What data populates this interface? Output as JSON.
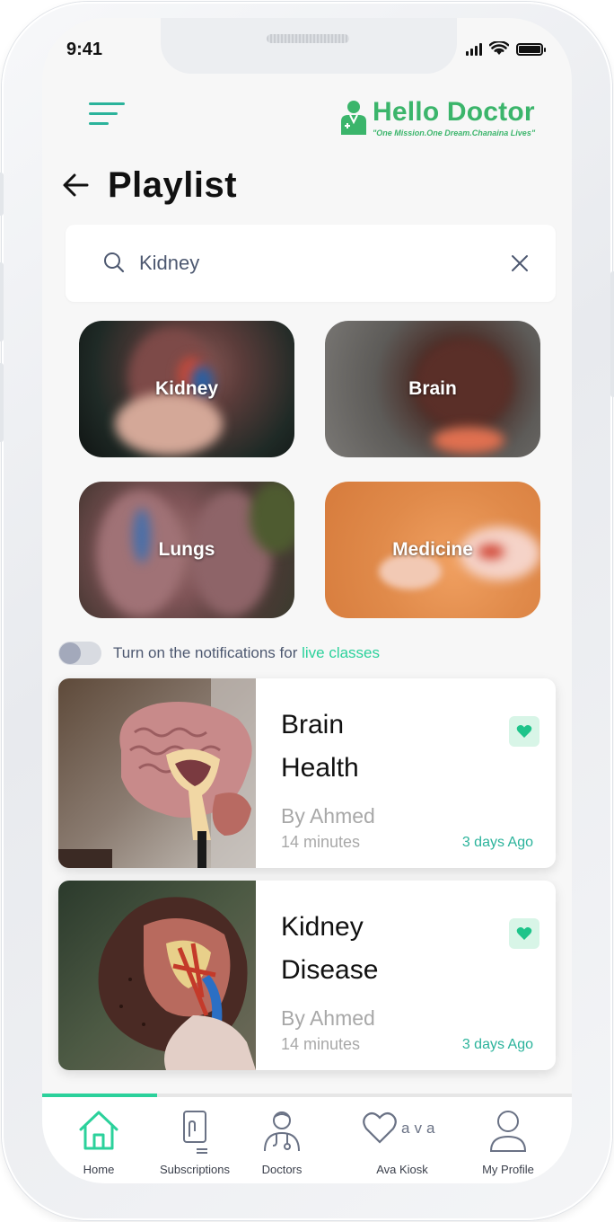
{
  "status_bar": {
    "time": "9:41"
  },
  "header": {
    "logo_text": "Hello Doctor",
    "logo_tagline": "\"One Mission.One Dream.Chanaina Lives\"",
    "page_title": "Playlist"
  },
  "search": {
    "value": "Kidney"
  },
  "categories": [
    {
      "label": "Kidney"
    },
    {
      "label": "Brain"
    },
    {
      "label": "Lungs"
    },
    {
      "label": "Medicine"
    }
  ],
  "notifications": {
    "text": "Turn on the notifications for ",
    "link": "live classes",
    "enabled": false
  },
  "videos": [
    {
      "title_line1": "Brain",
      "title_line2": "Health",
      "author": "By Ahmed",
      "duration": "14 minutes",
      "date": "3 days Ago",
      "favorited": true
    },
    {
      "title_line1": "Kidney",
      "title_line2": "Disease",
      "author": "By Ahmed",
      "duration": "14 minutes",
      "date": "3 days Ago",
      "favorited": true
    }
  ],
  "bottom_nav": {
    "active_index": 0,
    "items": [
      {
        "label": "Home",
        "icon": "home-icon"
      },
      {
        "label": "Subscriptions",
        "icon": "subscriptions-icon"
      },
      {
        "label": "Doctors",
        "icon": "doctor-icon"
      },
      {
        "label": "Ava Kiosk",
        "icon": "ava-heart-icon",
        "icon_text": "ava"
      },
      {
        "label": "My Profile",
        "icon": "profile-icon"
      }
    ]
  },
  "colors": {
    "accent": "#2bd19b",
    "brand": "#3bb56b",
    "text_dark": "#111111",
    "text_muted": "#a8a8a8"
  }
}
